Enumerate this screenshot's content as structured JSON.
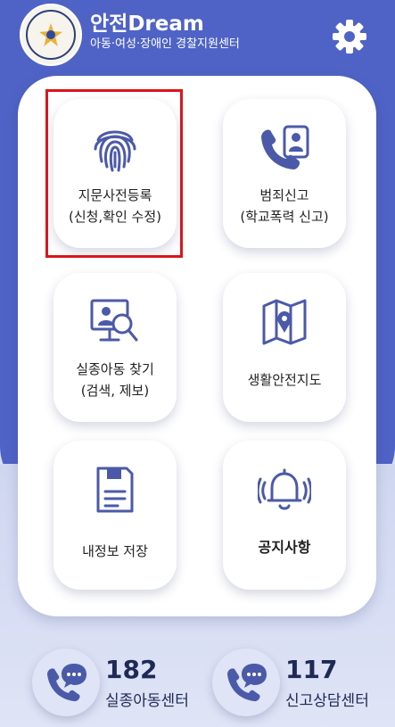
{
  "header": {
    "title": "안전Dream",
    "subtitle": "아동·여성·장애인 경찰지원센터",
    "emblem_icon": "police-emblem-icon",
    "settings_icon": "gear-icon"
  },
  "tiles": [
    {
      "line1": "지문사전등록",
      "line2": "(신청,확인 수정)",
      "icon": "fingerprint-icon",
      "selected": true
    },
    {
      "line1": "범죄신고",
      "line2": "(학교폭력 신고)",
      "icon": "phone-report-icon"
    },
    {
      "line1": "실종아동 찾기",
      "line2": "(검색, 제보)",
      "icon": "missing-search-icon"
    },
    {
      "line1": "생활안전지도",
      "line2": "",
      "icon": "map-pin-icon"
    },
    {
      "line1": "내정보 저장",
      "line2": "",
      "icon": "save-info-icon"
    },
    {
      "line1": "공지사항",
      "line2": "",
      "icon": "bell-icon"
    }
  ],
  "calls": [
    {
      "number": "182",
      "label": "실종아동센터",
      "icon": "phone-chat-icon"
    },
    {
      "number": "117",
      "label": "신고상담센터",
      "icon": "phone-chat-icon"
    }
  ],
  "colors": {
    "brand": "#4f63c6",
    "icon": "#4b5aa8",
    "highlight": "#d9161c"
  }
}
